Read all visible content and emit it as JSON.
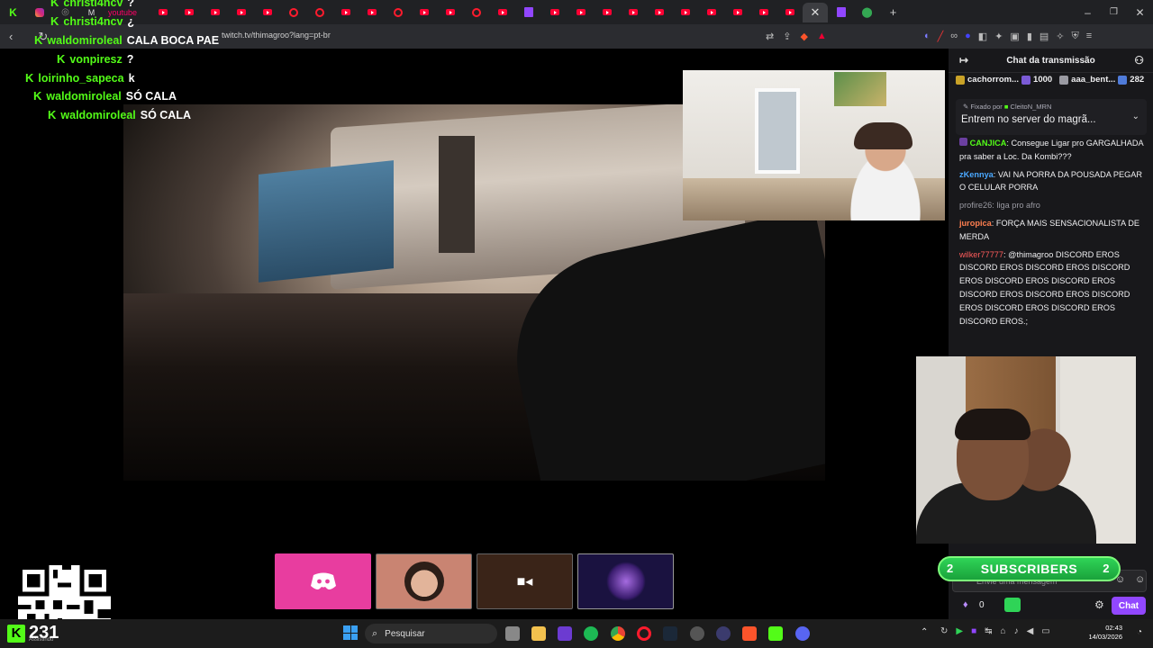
{
  "browser": {
    "url": "twitch.tv/thimagroo?lang=pt-br",
    "tab_youtube_label": "youtube"
  },
  "overlay_chat": [
    {
      "user": "christi4ncv",
      "message": "?"
    },
    {
      "user": "christi4ncv",
      "message": "¿"
    },
    {
      "user": "waldomiroleal",
      "message": "CALA BOCA PAE"
    },
    {
      "user": "vonpiresz",
      "message": "?"
    },
    {
      "user": "loirinho_sapeca",
      "message": "k"
    },
    {
      "user": "waldomiroleal",
      "message": "SÓ CALA"
    },
    {
      "user": "waldomiroleal",
      "message": "SÓ CALA"
    }
  ],
  "chat": {
    "title": "Chat da transmissão",
    "gifters": [
      {
        "name": "cachorrom...",
        "count": "1000",
        "color": "#c9a227"
      },
      {
        "name": "aaa_bent...",
        "count": "282",
        "color": "#4f7bd9"
      }
    ],
    "pinned_by_label": "Fixado por",
    "pinned_by_user": "CleitoN_MRN",
    "pinned_text": "Entrem no server do magrã...",
    "messages": [
      {
        "user": "CANJICA",
        "color": "#53fc18",
        "text": "Consegue Ligar pro GARGALHADA pra saber a Loc. Da Kombi???"
      },
      {
        "user": "zKennya",
        "color": "#4aa8ff",
        "text": "VAI NA PORRA DA POUSADA PEGAR O CELULAR PORRA"
      },
      {
        "user": "profire26",
        "color": "#9a9aa2",
        "text": "liga pro afro"
      },
      {
        "user": "juropica",
        "color": "#ff7f50",
        "text": "FORÇA MAIS SENSACIONALISTA DE MERDA"
      },
      {
        "user": "wilker77777",
        "color": "#ff5c5c",
        "text": "@thimagroo DISCORD EROS DISCORD EROS DISCORD EROS DISCORD EROS DISCORD EROS DISCORD EROS DISCORD EROS DISCORD EROS DISCORD EROS DISCORD EROS DISCORD EROS DISCORD EROS.;"
      }
    ],
    "input_placeholder": "Envie uma mensagem",
    "points": "0",
    "send_label": "Chat"
  },
  "subscribers_banner": {
    "label": "SUBSCRIBERS",
    "left_count": "2",
    "right_count": "2"
  },
  "kick": {
    "viewers": "231",
    "status": "Assistindo"
  },
  "taskbar": {
    "search_placeholder": "Pesquisar",
    "time": "02:43",
    "date": "14/03/2026"
  }
}
